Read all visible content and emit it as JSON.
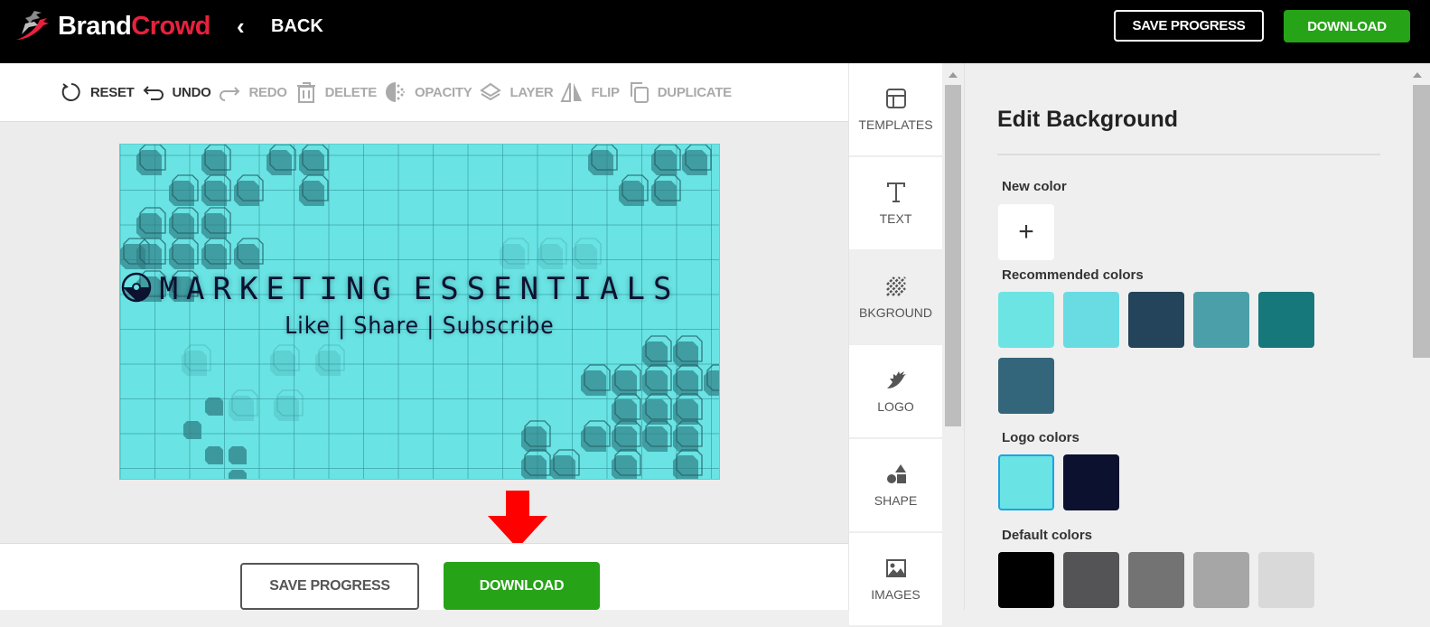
{
  "app": {
    "brand_part1": "Brand",
    "brand_part2": "Crowd",
    "back_label": "BACK"
  },
  "header": {
    "save_label": "SAVE PROGRESS",
    "download_label": "DOWNLOAD"
  },
  "toolbar": {
    "items": [
      {
        "label": "RESET",
        "icon": "reset-icon",
        "enabled": true
      },
      {
        "label": "UNDO",
        "icon": "undo-icon",
        "enabled": true
      },
      {
        "label": "REDO",
        "icon": "redo-icon",
        "enabled": false
      },
      {
        "label": "DELETE",
        "icon": "trash-icon",
        "enabled": false
      },
      {
        "label": "OPACITY",
        "icon": "opacity-icon",
        "enabled": false
      },
      {
        "label": "LAYER",
        "icon": "layers-icon",
        "enabled": false
      },
      {
        "label": "FLIP",
        "icon": "flip-icon",
        "enabled": false
      },
      {
        "label": "DUPLICATE",
        "icon": "duplicate-icon",
        "enabled": false
      }
    ]
  },
  "design": {
    "headline_left": "MARKETING",
    "headline_right": "ESSENTIALS",
    "subline": "Like | Share | Subscribe",
    "background_color": "#69e3e3",
    "text_color": "#0c1230"
  },
  "footer": {
    "save_label": "SAVE PROGRESS",
    "download_label": "DOWNLOAD"
  },
  "sidenav": {
    "items": [
      {
        "label": "TEMPLATES",
        "icon": "templates-icon",
        "active": false
      },
      {
        "label": "TEXT",
        "icon": "text-icon",
        "active": false
      },
      {
        "label": "BKGROUND",
        "icon": "background-icon",
        "active": true
      },
      {
        "label": "LOGO",
        "icon": "logo-icon",
        "active": false
      },
      {
        "label": "SHAPE",
        "icon": "shape-icon",
        "active": false
      },
      {
        "label": "IMAGES",
        "icon": "images-icon",
        "active": false
      }
    ]
  },
  "panel": {
    "title": "Edit Background",
    "new_color_label": "New color",
    "add_symbol": "+",
    "recommended_label": "Recommended colors",
    "recommended_colors": [
      "#6ce4e3",
      "#69dbe3",
      "#23445b",
      "#4b9fa8",
      "#17787c",
      "#33667a"
    ],
    "logo_label": "Logo colors",
    "logo_colors": [
      "#69e3e3",
      "#0b112e"
    ],
    "logo_selected_index": 0,
    "default_label": "Default colors",
    "default_colors": [
      "#000000",
      "#545456",
      "#737373",
      "#a6a6a6",
      "#d9d9d9"
    ]
  },
  "colors": {
    "brand_red": "#e8213d",
    "download_green": "#27a318",
    "selected_border": "#1ba4e0",
    "arrow_red": "#ff0000"
  }
}
